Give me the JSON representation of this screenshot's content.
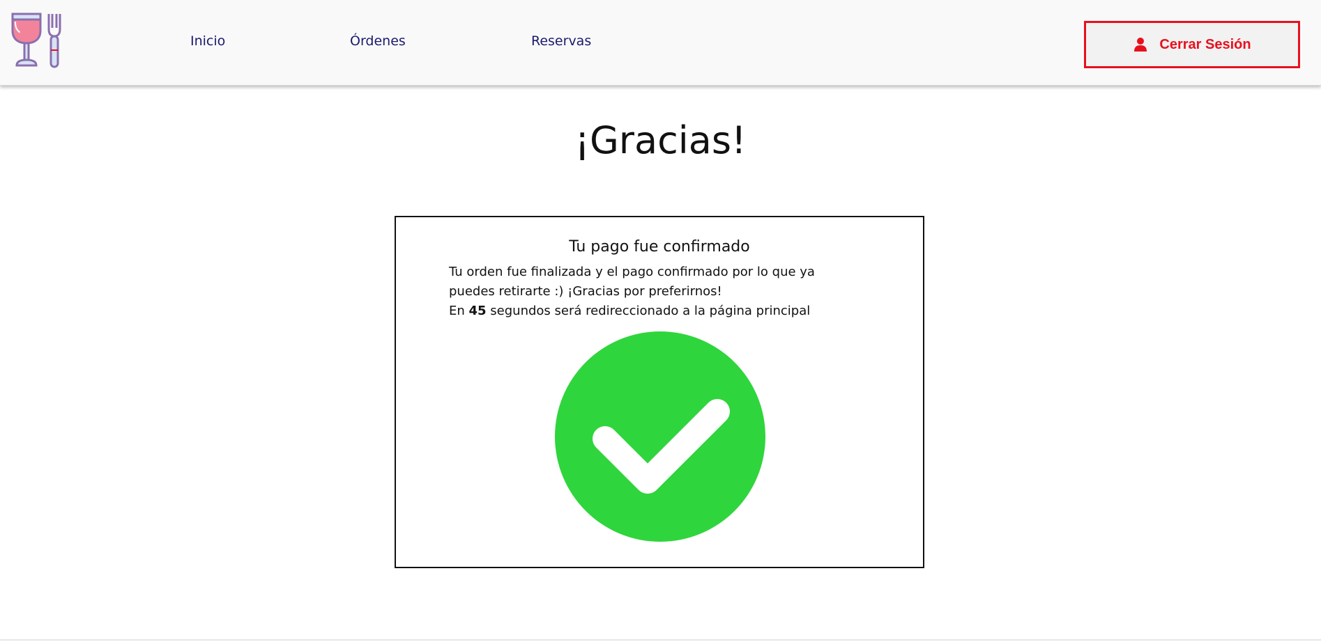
{
  "nav": {
    "logo_icon": "wine-glass-and-fork-icon",
    "links": [
      {
        "label": "Inicio"
      },
      {
        "label": "Órdenes"
      },
      {
        "label": "Reservas"
      }
    ],
    "logout": {
      "label": "Cerrar Sesión",
      "icon": "user-icon"
    }
  },
  "main": {
    "title": "¡Gracias!"
  },
  "card": {
    "title": "Tu pago fue confirmado",
    "line1": "Tu orden fue finalizada y el pago confirmado por lo que ya puedes retirarte :) ¡Gracias por preferirnos!",
    "countdown_prefix": "En ",
    "countdown_seconds": "45",
    "countdown_suffix": " segundos será redireccionado a la página principal",
    "status_icon": "check-circle-icon"
  },
  "colors": {
    "accent_red": "#e8101d",
    "nav_text": "#1a1a6e",
    "success_green": "#2fd53c"
  }
}
